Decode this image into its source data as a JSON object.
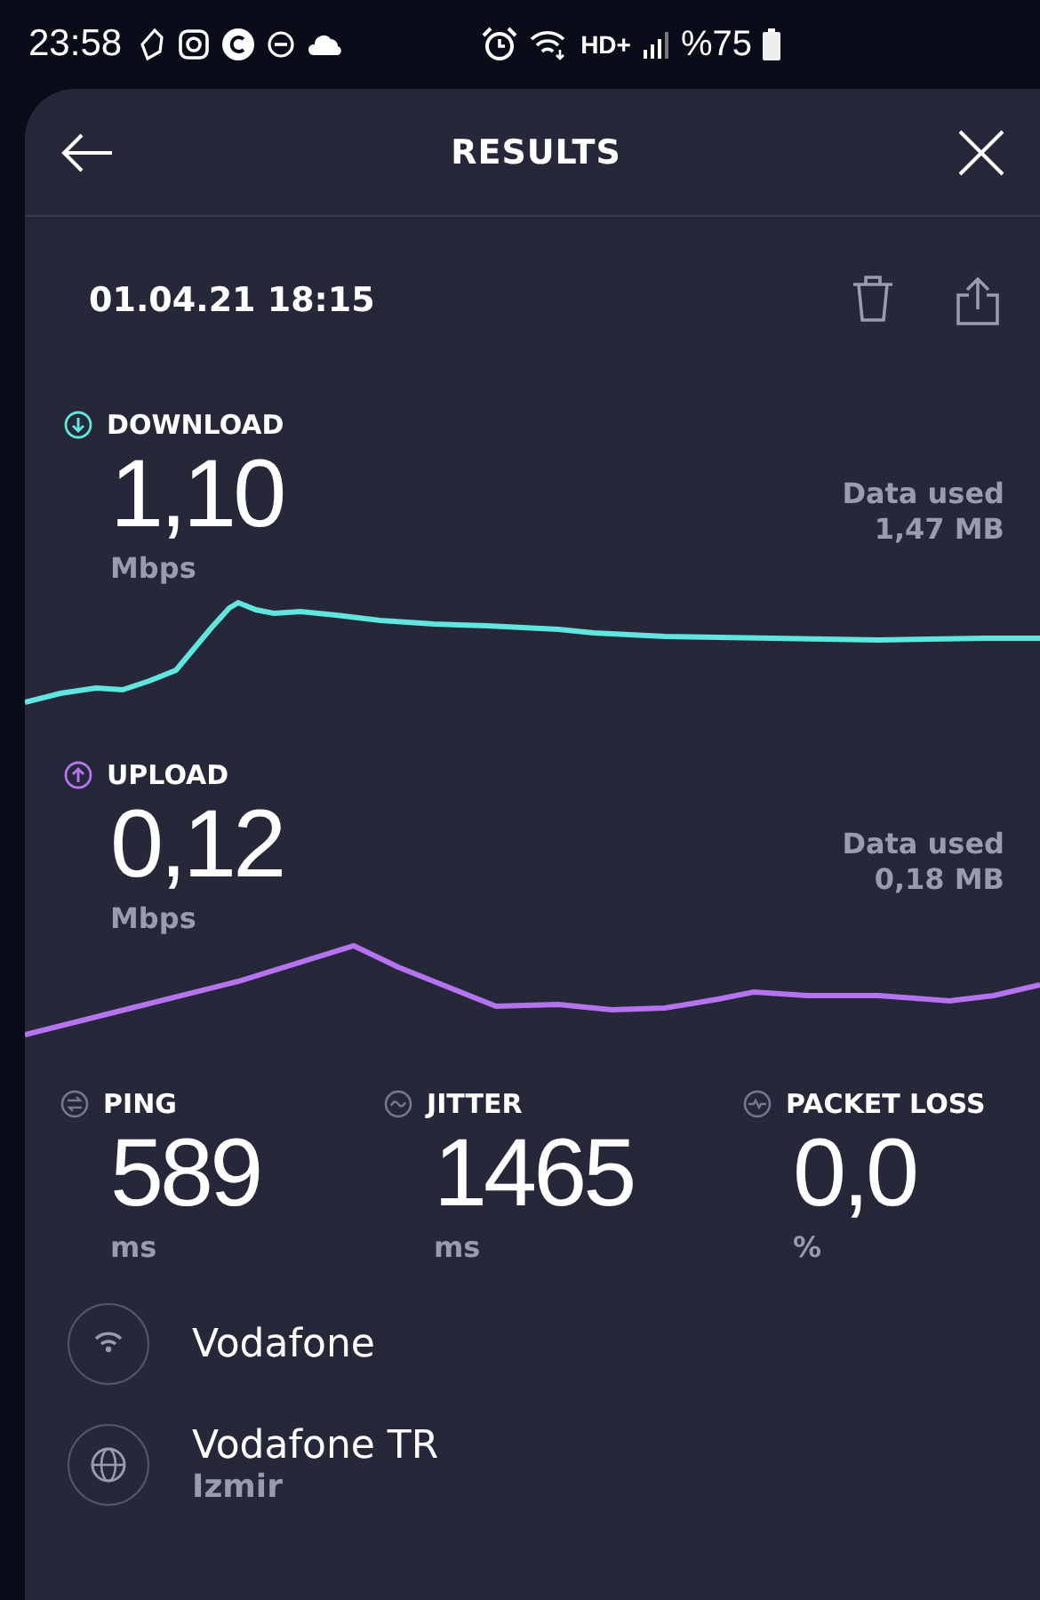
{
  "status_bar": {
    "time": "23:58",
    "network": "HD+",
    "battery": "%75"
  },
  "header": {
    "title": "RESULTS"
  },
  "test": {
    "date": "01.04.21 18:15"
  },
  "speeds": [
    {
      "kind": "download",
      "label": "DOWNLOAD",
      "value": "1,10",
      "unit": "Mbps",
      "data_label": "Data used",
      "data_value": "1,47 MB",
      "color": "#5fe6df"
    },
    {
      "kind": "upload",
      "label": "UPLOAD",
      "value": "0,12",
      "unit": "Mbps",
      "data_label": "Data used",
      "data_value": "0,18 MB",
      "color": "#b673f0"
    }
  ],
  "stats": [
    {
      "kind": "ping",
      "label": "PING",
      "value": "589",
      "unit": "ms"
    },
    {
      "kind": "jitter",
      "label": "JITTER",
      "value": "1465",
      "unit": "ms"
    },
    {
      "kind": "packet_loss",
      "label": "PACKET LOSS",
      "value": "0,0",
      "unit": "%"
    }
  ],
  "connection": [
    {
      "kind": "wifi",
      "name": "Vodafone"
    },
    {
      "kind": "globe",
      "name": "Vodafone TR",
      "location": "Izmir"
    }
  ]
}
